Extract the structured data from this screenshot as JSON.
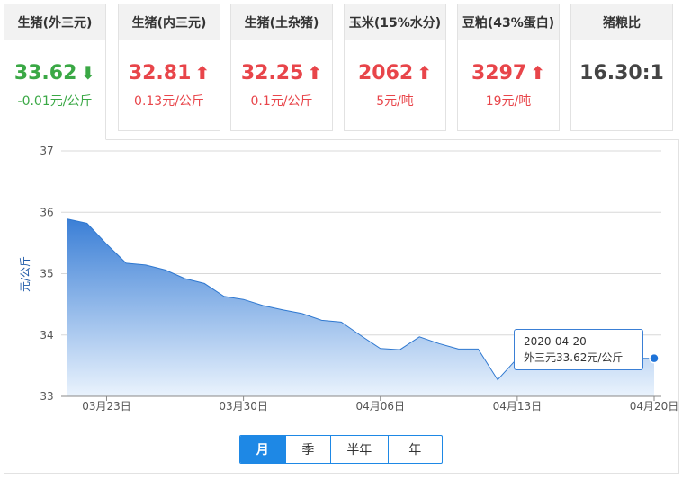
{
  "cards": [
    {
      "title": "生猪(外三元)",
      "price": "33.62",
      "dir": "down",
      "arrow": "⬇",
      "change": "-0.01元/公斤"
    },
    {
      "title": "生猪(内三元)",
      "price": "32.81",
      "dir": "up",
      "arrow": "⬆",
      "change": "0.13元/公斤"
    },
    {
      "title": "生猪(土杂猪)",
      "price": "32.25",
      "dir": "up",
      "arrow": "⬆",
      "change": "0.1元/公斤"
    },
    {
      "title": "玉米(15%水分)",
      "price": "2062",
      "dir": "up",
      "arrow": "⬆",
      "change": "5元/吨"
    },
    {
      "title": "豆粕(43%蛋白)",
      "price": "3297",
      "dir": "up",
      "arrow": "⬆",
      "change": "19元/吨"
    },
    {
      "title": "猪粮比",
      "price": "16.30:1",
      "dir": "neutral",
      "arrow": "",
      "change": ""
    }
  ],
  "tabs": [
    {
      "label": "月",
      "active": true
    },
    {
      "label": "季",
      "active": false
    },
    {
      "label": "半年",
      "active": false
    },
    {
      "label": "年",
      "active": false
    }
  ],
  "tooltip": {
    "date": "2020-04-20",
    "text": "外三元33.62元/公斤"
  },
  "colors": {
    "up": "#e8454a",
    "down": "#3aa845",
    "accent": "#1e88e5",
    "area_top": "#3b7fd6",
    "area_bottom": "#eaf3fd"
  },
  "chart_data": {
    "type": "area",
    "ylabel": "元/公斤",
    "ylim": [
      33,
      37
    ],
    "yticks": [
      33,
      34,
      35,
      36,
      37
    ],
    "xtick_labels": [
      "03月23日",
      "03月30日",
      "04月06日",
      "04月13日",
      "04月20日"
    ],
    "grid": true,
    "x": [
      "03-21",
      "03-22",
      "03-23",
      "03-24",
      "03-25",
      "03-26",
      "03-27",
      "03-28",
      "03-29",
      "03-30",
      "03-31",
      "04-01",
      "04-02",
      "04-03",
      "04-04",
      "04-05",
      "04-06",
      "04-07",
      "04-08",
      "04-09",
      "04-10",
      "04-11",
      "04-12",
      "04-13",
      "04-14",
      "04-15",
      "04-16",
      "04-17",
      "04-18",
      "04-19",
      "04-20"
    ],
    "series": [
      {
        "values": [
          35.89,
          35.82,
          35.48,
          35.17,
          35.14,
          35.06,
          34.92,
          34.84,
          34.63,
          34.58,
          34.48,
          34.41,
          34.35,
          34.24,
          34.21,
          33.99,
          33.78,
          33.76,
          33.97,
          33.86,
          33.77,
          33.77,
          33.27,
          33.62,
          33.62,
          33.62,
          33.62,
          33.62,
          33.62,
          33.62,
          33.62
        ]
      }
    ],
    "highlight": {
      "x": "04-20",
      "y": 33.62
    }
  }
}
